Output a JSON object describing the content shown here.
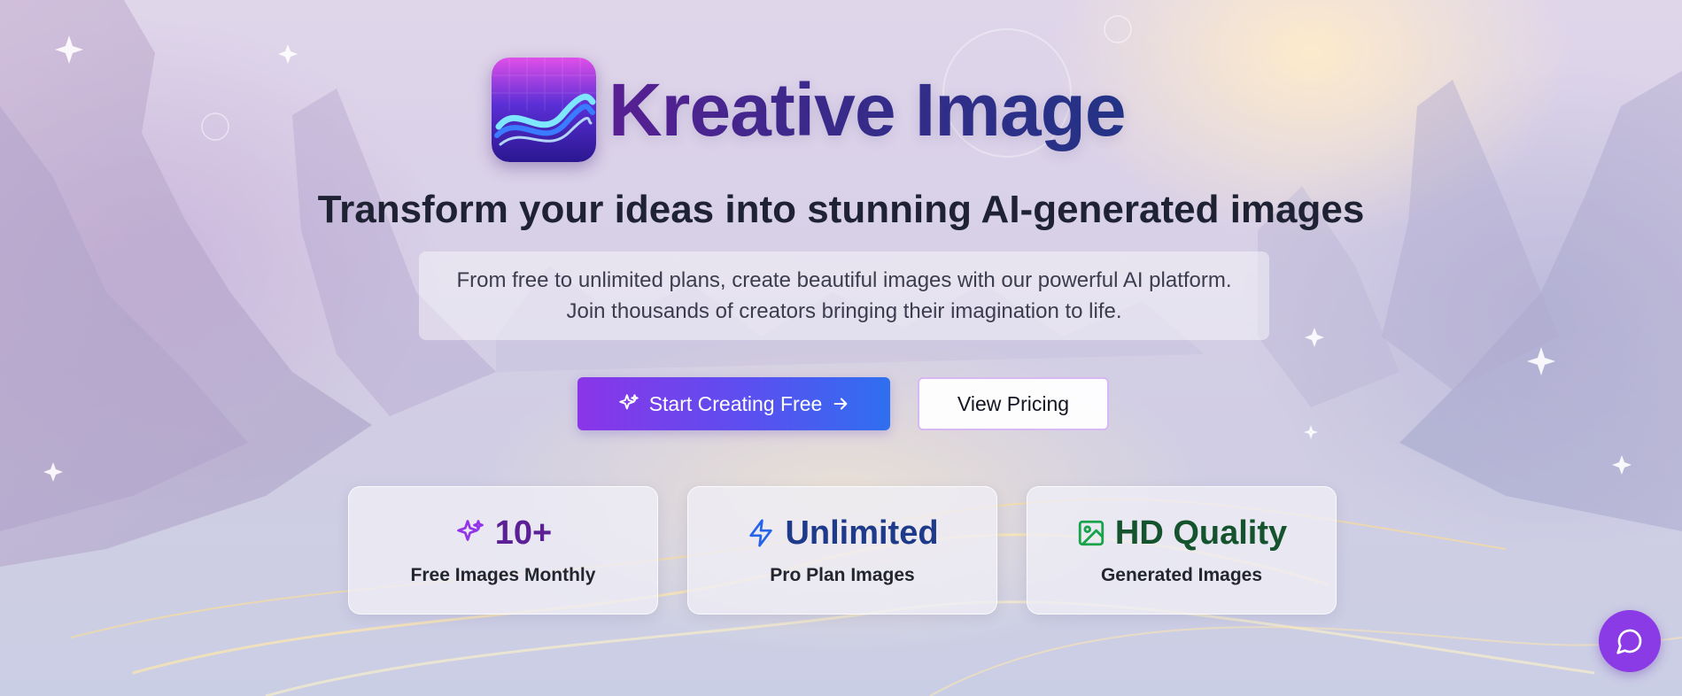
{
  "brand": {
    "name": "Kreative Image",
    "logo_icon": "wave-logo-icon"
  },
  "hero": {
    "tagline": "Transform your ideas into stunning AI-generated images",
    "description": "From free to unlimited plans, create beautiful images with our powerful AI platform. Join thousands of creators bringing their imagination to life."
  },
  "actions": {
    "primary_label": "Start Creating Free",
    "primary_icons": [
      "sparkles-icon",
      "arrow-right-icon"
    ],
    "secondary_label": "View Pricing"
  },
  "stats": [
    {
      "value": "10+",
      "label": "Free Images Monthly",
      "icon": "sparkles-icon",
      "color": "#5b1f96",
      "icon_color": "#9333ea"
    },
    {
      "value": "Unlimited",
      "label": "Pro Plan Images",
      "icon": "lightning-icon",
      "color": "#1e3a8a",
      "icon_color": "#2563eb"
    },
    {
      "value": "HD Quality",
      "label": "Generated Images",
      "icon": "image-icon",
      "color": "#14532d",
      "icon_color": "#16a34a"
    }
  ],
  "chat": {
    "icon": "chat-bubble-icon",
    "color": "#8a3be6"
  },
  "colors": {
    "primary_gradient_start": "#8a35e8",
    "primary_gradient_end": "#2f6ff0",
    "tagline": "#1f2233"
  }
}
